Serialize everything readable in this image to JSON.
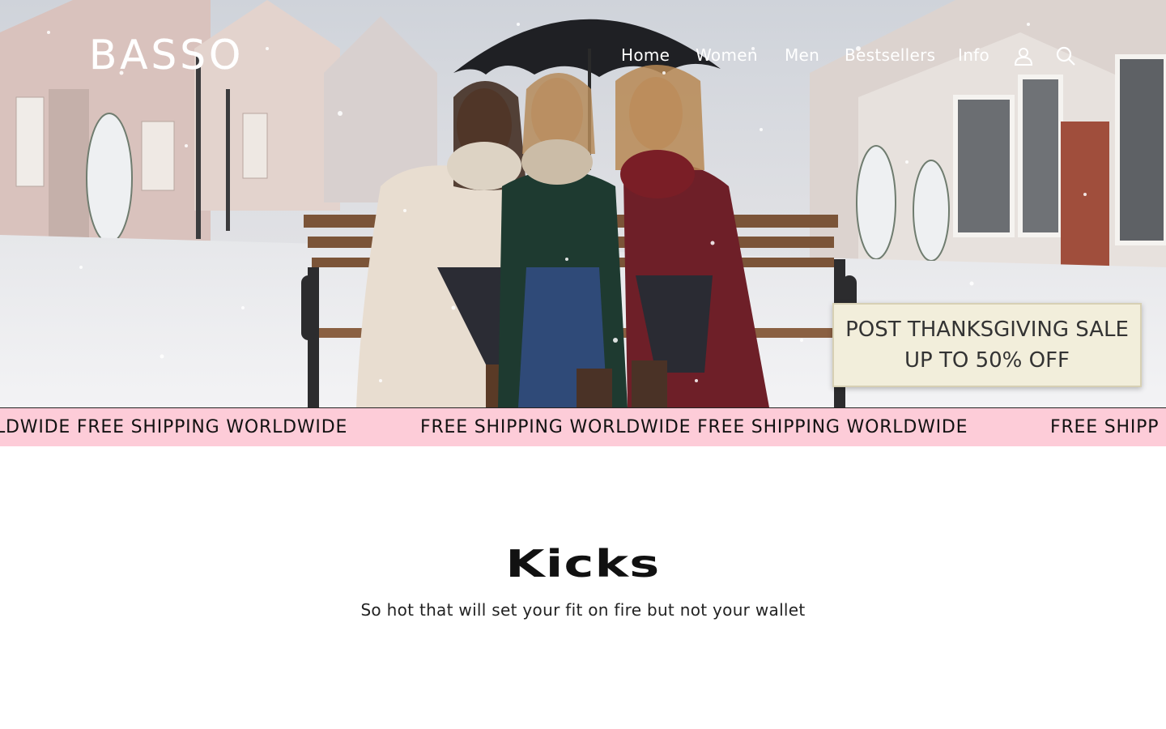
{
  "brand": {
    "logo_text": "BASSO"
  },
  "nav": {
    "items": [
      {
        "label": "Home"
      },
      {
        "label": "Women"
      },
      {
        "label": "Men"
      },
      {
        "label": "Bestsellers"
      },
      {
        "label": "Info"
      }
    ],
    "account_icon": "user-icon",
    "search_icon": "search-icon"
  },
  "hero": {
    "image_alt": "",
    "badge": {
      "line1": "POST THANKSGIVING SALE",
      "line2": "UP TO 50% OFF"
    }
  },
  "announcement": {
    "items": [
      "LDWIDE FREE SHIPPING WORLDWIDE",
      "FREE SHIPPING WORLDWIDE FREE SHIPPING WORLDWIDE",
      "FREE SHIPP"
    ],
    "background_color": "#fdccd8"
  },
  "collection": {
    "title": "Kicks",
    "subtitle": "So hot that will set your fit on fire but not your wallet"
  }
}
